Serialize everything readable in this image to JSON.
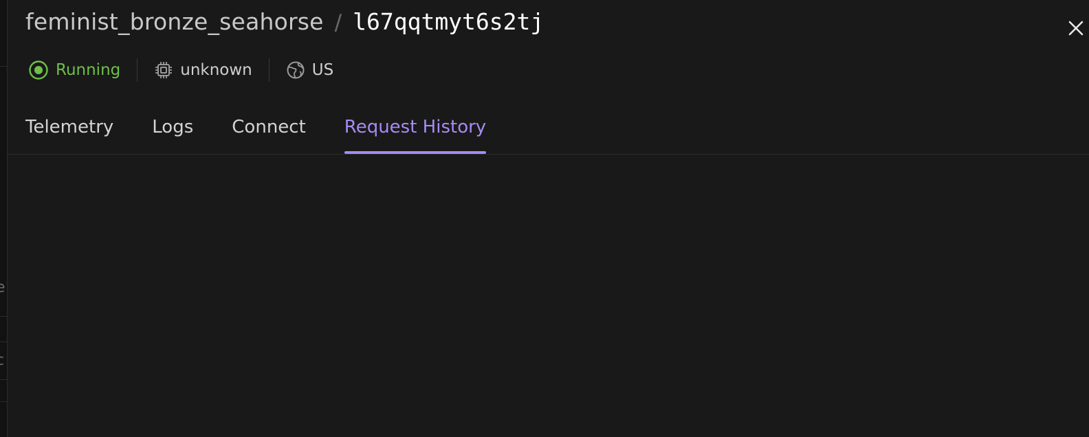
{
  "header": {
    "app_name": "feminist_bronze_seahorse",
    "separator": "/",
    "machine_id": "l67qqtmyt6s2tj"
  },
  "status": {
    "label": "Running",
    "color": "#6fbf4a",
    "icon": "status-dot-icon"
  },
  "cpu": {
    "label": "unknown",
    "icon": "cpu-icon"
  },
  "region": {
    "label": "US",
    "icon": "globe-icon"
  },
  "tabs": [
    {
      "label": "Telemetry",
      "active": false
    },
    {
      "label": "Logs",
      "active": false
    },
    {
      "label": "Connect",
      "active": false
    },
    {
      "label": "Request History",
      "active": true
    }
  ],
  "accent_color": "#a58cf2",
  "backdrop": {
    "fragment_1": "e",
    "fragment_2": "c"
  }
}
